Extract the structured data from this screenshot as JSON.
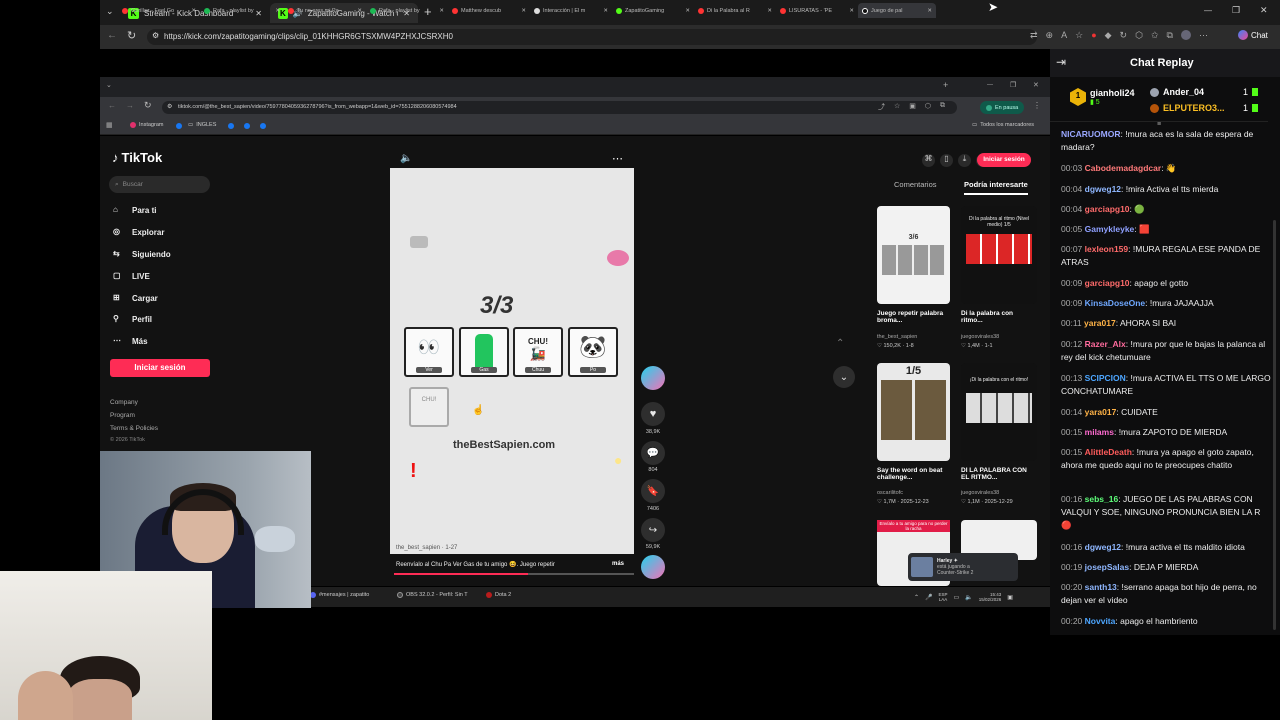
{
  "outer_browser": {
    "tabs": [
      {
        "label": "Stream - Kick Dashboard"
      },
      {
        "label": "ZapatitoGaming - Watch clip"
      }
    ],
    "url": "https://kick.com/zapatitogaming/clips/clip_01KHHGR6GTSXMW4PZHXJCSRXH0",
    "chat_button": "Chat"
  },
  "inner_browser": {
    "tabs": [
      "Gorillaz - Feel Go",
      "Rafa - playlist by",
      "Tu no eres mi Pa",
      "Rafa - playlist by",
      "Matthew descub",
      "Interacción | El m",
      "ZapatitoGaming",
      "Di la Palabra al R",
      "LISURATAS - 'PE",
      "Juego de pal"
    ],
    "url": "tiktok.com/@the_best_sapien/video/7597780405936278796?is_from_webapp=1&web_id=7551288206080574984",
    "status_badge": "En pausa",
    "bookmarks": [
      "Instagram",
      "INGLES"
    ],
    "all_bookmarks": "Todos los marcadores"
  },
  "tiktok": {
    "logo": "TikTok",
    "search_placeholder": "Buscar",
    "nav": [
      "Para ti",
      "Explorar",
      "Siguiendo",
      "LIVE",
      "Cargar",
      "Perfil",
      "Más"
    ],
    "login": "Iniciar sesión",
    "footer": [
      "Company",
      "Program",
      "Terms & Policies",
      "© 2026 TikTok"
    ],
    "video": {
      "counter": "3/3",
      "cards": [
        "Ver",
        "Gas",
        "Chuu",
        "Po"
      ],
      "chu_text": "CHU!",
      "site": "theBestSapien.com",
      "author": "the_best_sapien · 1-27",
      "caption": "Reenvíalo al Chu Pa Ver Gas de tu amigo 😆. Juego repetir",
      "more": "más"
    },
    "actions": {
      "likes": "38,9K",
      "comments": "804",
      "saves": "7406",
      "shares": "59,9K"
    },
    "right_tabs": [
      "Comentarios",
      "Podría interesarte"
    ],
    "top_login": "Iniciar sesión",
    "suggestions": [
      {
        "counter": "3/6",
        "title": "Juego repetir palabra broma...",
        "user": "the_best_sapien",
        "stats": "♡ 150,2K · 1-8"
      },
      {
        "counter": "Di la palabra al ritmo (Nivel medio) 1/5",
        "title": "Di la palabra con ritmo...",
        "user": "juegosvirales38",
        "stats": "♡ 1,4M · 1-1"
      },
      {
        "counter": "1/5",
        "title": "Say the word on beat challenge...",
        "user": "oscarilitofc",
        "stats": "♡ 1,7M · 2025-12-23"
      },
      {
        "counter": "¡Di la palabra con el ritmo!",
        "title": "DI LA PALABRA CON EL RITMO...",
        "user": "juegosvirales38",
        "stats": "♡ 1,1M · 2025-12-29"
      },
      {
        "counter": "Envíalo a tu amigo para no perder la racha"
      }
    ]
  },
  "taskbar": {
    "items": [
      "#mensajes | zapatito",
      "OBS 32.0.2 - Perfil: Sin T",
      "Dota 2"
    ],
    "toast": "Harley ✦",
    "toast_sub": "está jugando a",
    "toast_game": "Counter-Strike 2",
    "lang": "ESP",
    "lang2": "LAA",
    "time": "15:43",
    "date": "15/02/2026"
  },
  "chat": {
    "title": "Chat Replay",
    "leaderboard": [
      {
        "name": "gianholi24",
        "sub": "5",
        "count": "1"
      },
      {
        "name": "Ander_04",
        "count": "1"
      },
      {
        "name": "ELPUTERO3...",
        "count": "1"
      }
    ],
    "messages": [
      {
        "time": "",
        "user": "NICARUOMOR",
        "color": "#9aa7ff",
        "text": "!mura aca es la sala de espera de madara?"
      },
      {
        "time": "00:03",
        "user": "Cabodemadagdcar",
        "color": "#ff7a7a",
        "text": "👋"
      },
      {
        "time": "00:04",
        "user": "dgweg12",
        "color": "#8fb7ff",
        "text": "!mira Activa el tts mierda"
      },
      {
        "time": "00:04",
        "user": "garciapg10",
        "color": "#ff6b6b",
        "text": "🟢"
      },
      {
        "time": "00:05",
        "user": "Gamykleyke",
        "color": "#8fa0ff",
        "text": "🟥"
      },
      {
        "time": "00:07",
        "user": "lexleon159",
        "color": "#ff6b6b",
        "text": "!MURA REGALA ESE PANDA DE ATRAS"
      },
      {
        "time": "00:09",
        "user": "garciapg10",
        "color": "#ff6b6b",
        "text": "apago el gotto"
      },
      {
        "time": "00:09",
        "user": "KinsaDoseOne",
        "color": "#6fa8ff",
        "text": "!mura JAJAAJJA"
      },
      {
        "time": "00:11",
        "user": "yara017",
        "color": "#ffb347",
        "text": "AHORA SI BAI"
      },
      {
        "time": "00:12",
        "user": "Razer_Alx",
        "color": "#ff6b9d",
        "text": "!mura por que le bajas la palanca al rey del kick chetumuare"
      },
      {
        "time": "00:13",
        "user": "SCIPCION",
        "color": "#4da6ff",
        "text": "!mura ACTIVA EL TTS O ME LARGO CONCHATUMARE"
      },
      {
        "time": "00:14",
        "user": "yara017",
        "color": "#ffb347",
        "text": "CUIDATE"
      },
      {
        "time": "00:15",
        "user": "milams",
        "color": "#ff6bd0",
        "text": "!mura ZAPOTO DE MIERDA"
      },
      {
        "time": "00:15",
        "user": "AlittleDeath",
        "color": "#ff5c5c",
        "text": "!mura ya apago el goto zapato, ahora me quedo aqui no te preocupes chatito"
      },
      {
        "time": "00:16",
        "user": "sebs_16",
        "color": "#5eff7a",
        "text": "JUEGO DE LAS PALABRAS CON VALQUI Y SOE, NINGUNO PRONUNCIA BIEN LA R 🔴"
      },
      {
        "time": "00:16",
        "user": "dgweg12",
        "color": "#8fb7ff",
        "text": "!mura activa el tts maldito idiota"
      },
      {
        "time": "00:19",
        "user": "josepSalas",
        "color": "#8fb7ff",
        "text": "DEJA P MIERDA"
      },
      {
        "time": "00:20",
        "user": "santh13",
        "color": "#8fb7ff",
        "text": "!serrano apaga bot hijo de perra, no dejan ver el video"
      },
      {
        "time": "00:20",
        "user": "Novvita",
        "color": "#4da6ff",
        "text": "apago el hambriento"
      }
    ]
  }
}
